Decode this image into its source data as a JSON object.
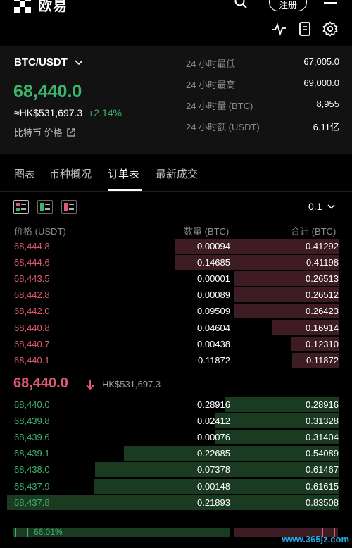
{
  "app": {
    "logo_text": "欧易",
    "register_label": "注册"
  },
  "colors": {
    "up": "#3bb56b",
    "down": "#e05a73",
    "ask_bar": "#3d1c23",
    "bid_bar": "#1a3b22"
  },
  "ticker": {
    "pair": "BTC/USDT",
    "last_price": "68,440.0",
    "fiat_price": "≈HK$531,697.3",
    "change": "+2.14%",
    "link_label": "比特币 价格",
    "stats": [
      {
        "label": "24 小时最低",
        "value": "67,005.0"
      },
      {
        "label": "24 小时最高",
        "value": "69,000.0"
      },
      {
        "label": "24 小时量 (BTC)",
        "value": "8,955"
      },
      {
        "label": "24 小时额 (USDT)",
        "value": "6.11亿"
      }
    ]
  },
  "tabs": [
    {
      "label": "图表"
    },
    {
      "label": "币种概况"
    },
    {
      "label": "订单表"
    },
    {
      "label": "最新成交"
    }
  ],
  "orderbook": {
    "precision": "0.1",
    "columns": {
      "price": "价格 (USDT)",
      "qty": "数量 (BTC)",
      "total": "合计 (BTC)"
    },
    "asks": [
      {
        "price": "68,444.8",
        "qty": "0.00094",
        "total": "0.41292",
        "depth": 0.494
      },
      {
        "price": "68,444.6",
        "qty": "0.14685",
        "total": "0.41198",
        "depth": 0.493
      },
      {
        "price": "68,443.5",
        "qty": "0.00001",
        "total": "0.26513",
        "depth": 0.317
      },
      {
        "price": "68,442.8",
        "qty": "0.00089",
        "total": "0.26512",
        "depth": 0.317
      },
      {
        "price": "68,442.0",
        "qty": "0.09509",
        "total": "0.26423",
        "depth": 0.316
      },
      {
        "price": "68,440.8",
        "qty": "0.04604",
        "total": "0.16914",
        "depth": 0.203
      },
      {
        "price": "68,440.7",
        "qty": "0.00438",
        "total": "0.12310",
        "depth": 0.147
      },
      {
        "price": "68,440.1",
        "qty": "0.11872",
        "total": "0.11872",
        "depth": 0.142
      }
    ],
    "mid_price": "68,440.0",
    "mid_fiat": "HK$531,697.3",
    "bids": [
      {
        "price": "68,440.0",
        "qty": "0.28916",
        "total": "0.28916",
        "depth": 0.346
      },
      {
        "price": "68,439.8",
        "qty": "0.02412",
        "total": "0.31328",
        "depth": 0.375
      },
      {
        "price": "68,439.6",
        "qty": "0.00076",
        "total": "0.31404",
        "depth": 0.376
      },
      {
        "price": "68,439.1",
        "qty": "0.22685",
        "total": "0.54089",
        "depth": 0.648
      },
      {
        "price": "68,438.0",
        "qty": "0.07378",
        "total": "0.61467",
        "depth": 0.736
      },
      {
        "price": "68,437.9",
        "qty": "0.00148",
        "total": "0.61615",
        "depth": 0.738
      },
      {
        "price": "68,437.8",
        "qty": "0.21893",
        "total": "0.83508",
        "depth": 1.0
      }
    ]
  },
  "ratio": {
    "buy_pct": "66.01%"
  },
  "watermark": "www.365jz.com"
}
